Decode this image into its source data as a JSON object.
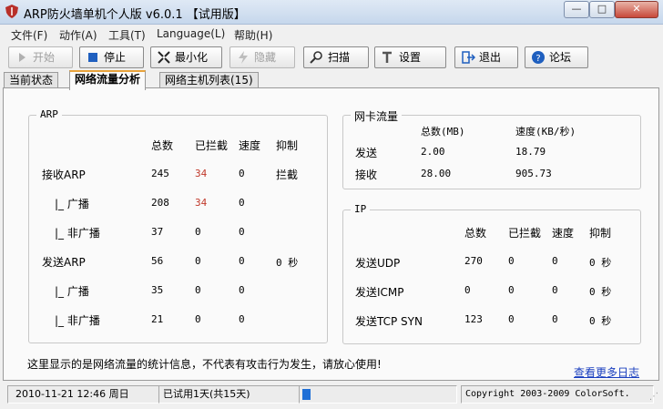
{
  "window": {
    "title": "ARP防火墙单机个人版 v6.0.1 【试用版】"
  },
  "menu": [
    "文件(F)",
    "动作(A)",
    "工具(T)",
    "Language(L)",
    "帮助(H)"
  ],
  "toolbar": {
    "start": "开始",
    "stop": "停止",
    "minimize": "最小化",
    "hide": "隐藏",
    "scan": "扫描",
    "settings": "设置",
    "exit": "退出",
    "forum": "论坛"
  },
  "tabs": [
    "当前状态",
    "网络流量分析",
    "网络主机列表(15)"
  ],
  "arp": {
    "legend": "ARP",
    "headers": [
      "总数",
      "已拦截",
      "速度",
      "抑制"
    ],
    "rows": [
      {
        "label": "接收ARP",
        "total": "245",
        "blocked": "34",
        "speed": "0",
        "suppress": "拦截"
      },
      {
        "label": "|_ 广播",
        "total": "208",
        "blocked": "34",
        "speed": "0",
        "suppress": ""
      },
      {
        "label": "|_ 非广播",
        "total": "37",
        "blocked": "0",
        "speed": "0",
        "suppress": ""
      },
      {
        "label": "发送ARP",
        "total": "56",
        "blocked": "0",
        "speed": "0",
        "suppress": "0 秒"
      },
      {
        "label": "|_ 广播",
        "total": "35",
        "blocked": "0",
        "speed": "0",
        "suppress": ""
      },
      {
        "label": "|_ 非广播",
        "total": "21",
        "blocked": "0",
        "speed": "0",
        "suppress": ""
      }
    ]
  },
  "nic": {
    "legend": "网卡流量",
    "headers": [
      "总数(MB)",
      "速度(KB/秒)"
    ],
    "rows": [
      {
        "label": "发送",
        "total": "2.00",
        "speed": "18.79"
      },
      {
        "label": "接收",
        "total": "28.00",
        "speed": "905.73"
      }
    ]
  },
  "ip": {
    "legend": "IP",
    "headers": [
      "总数",
      "已拦截",
      "速度",
      "抑制"
    ],
    "rows": [
      {
        "label": "发送UDP",
        "total": "270",
        "blocked": "0",
        "speed": "0",
        "suppress": "0 秒"
      },
      {
        "label": "发送ICMP",
        "total": "0",
        "blocked": "0",
        "speed": "0",
        "suppress": "0 秒"
      },
      {
        "label": "发送TCP SYN",
        "total": "123",
        "blocked": "0",
        "speed": "0",
        "suppress": "0 秒"
      }
    ]
  },
  "info": "这里显示的是网络流量的统计信息，不代表有攻击行为发生，请放心使用!",
  "log_link": "查看更多日志",
  "status": {
    "datetime": "2010-11-21 12:46 周日",
    "trial": "已试用1天(共15天)",
    "copyright": "Copyright 2003-2009 ColorSoft."
  },
  "colors": {
    "blocked_red": "#c0392b",
    "link_blue": "#1a3fbf",
    "tab_accent": "#e8a33b"
  }
}
